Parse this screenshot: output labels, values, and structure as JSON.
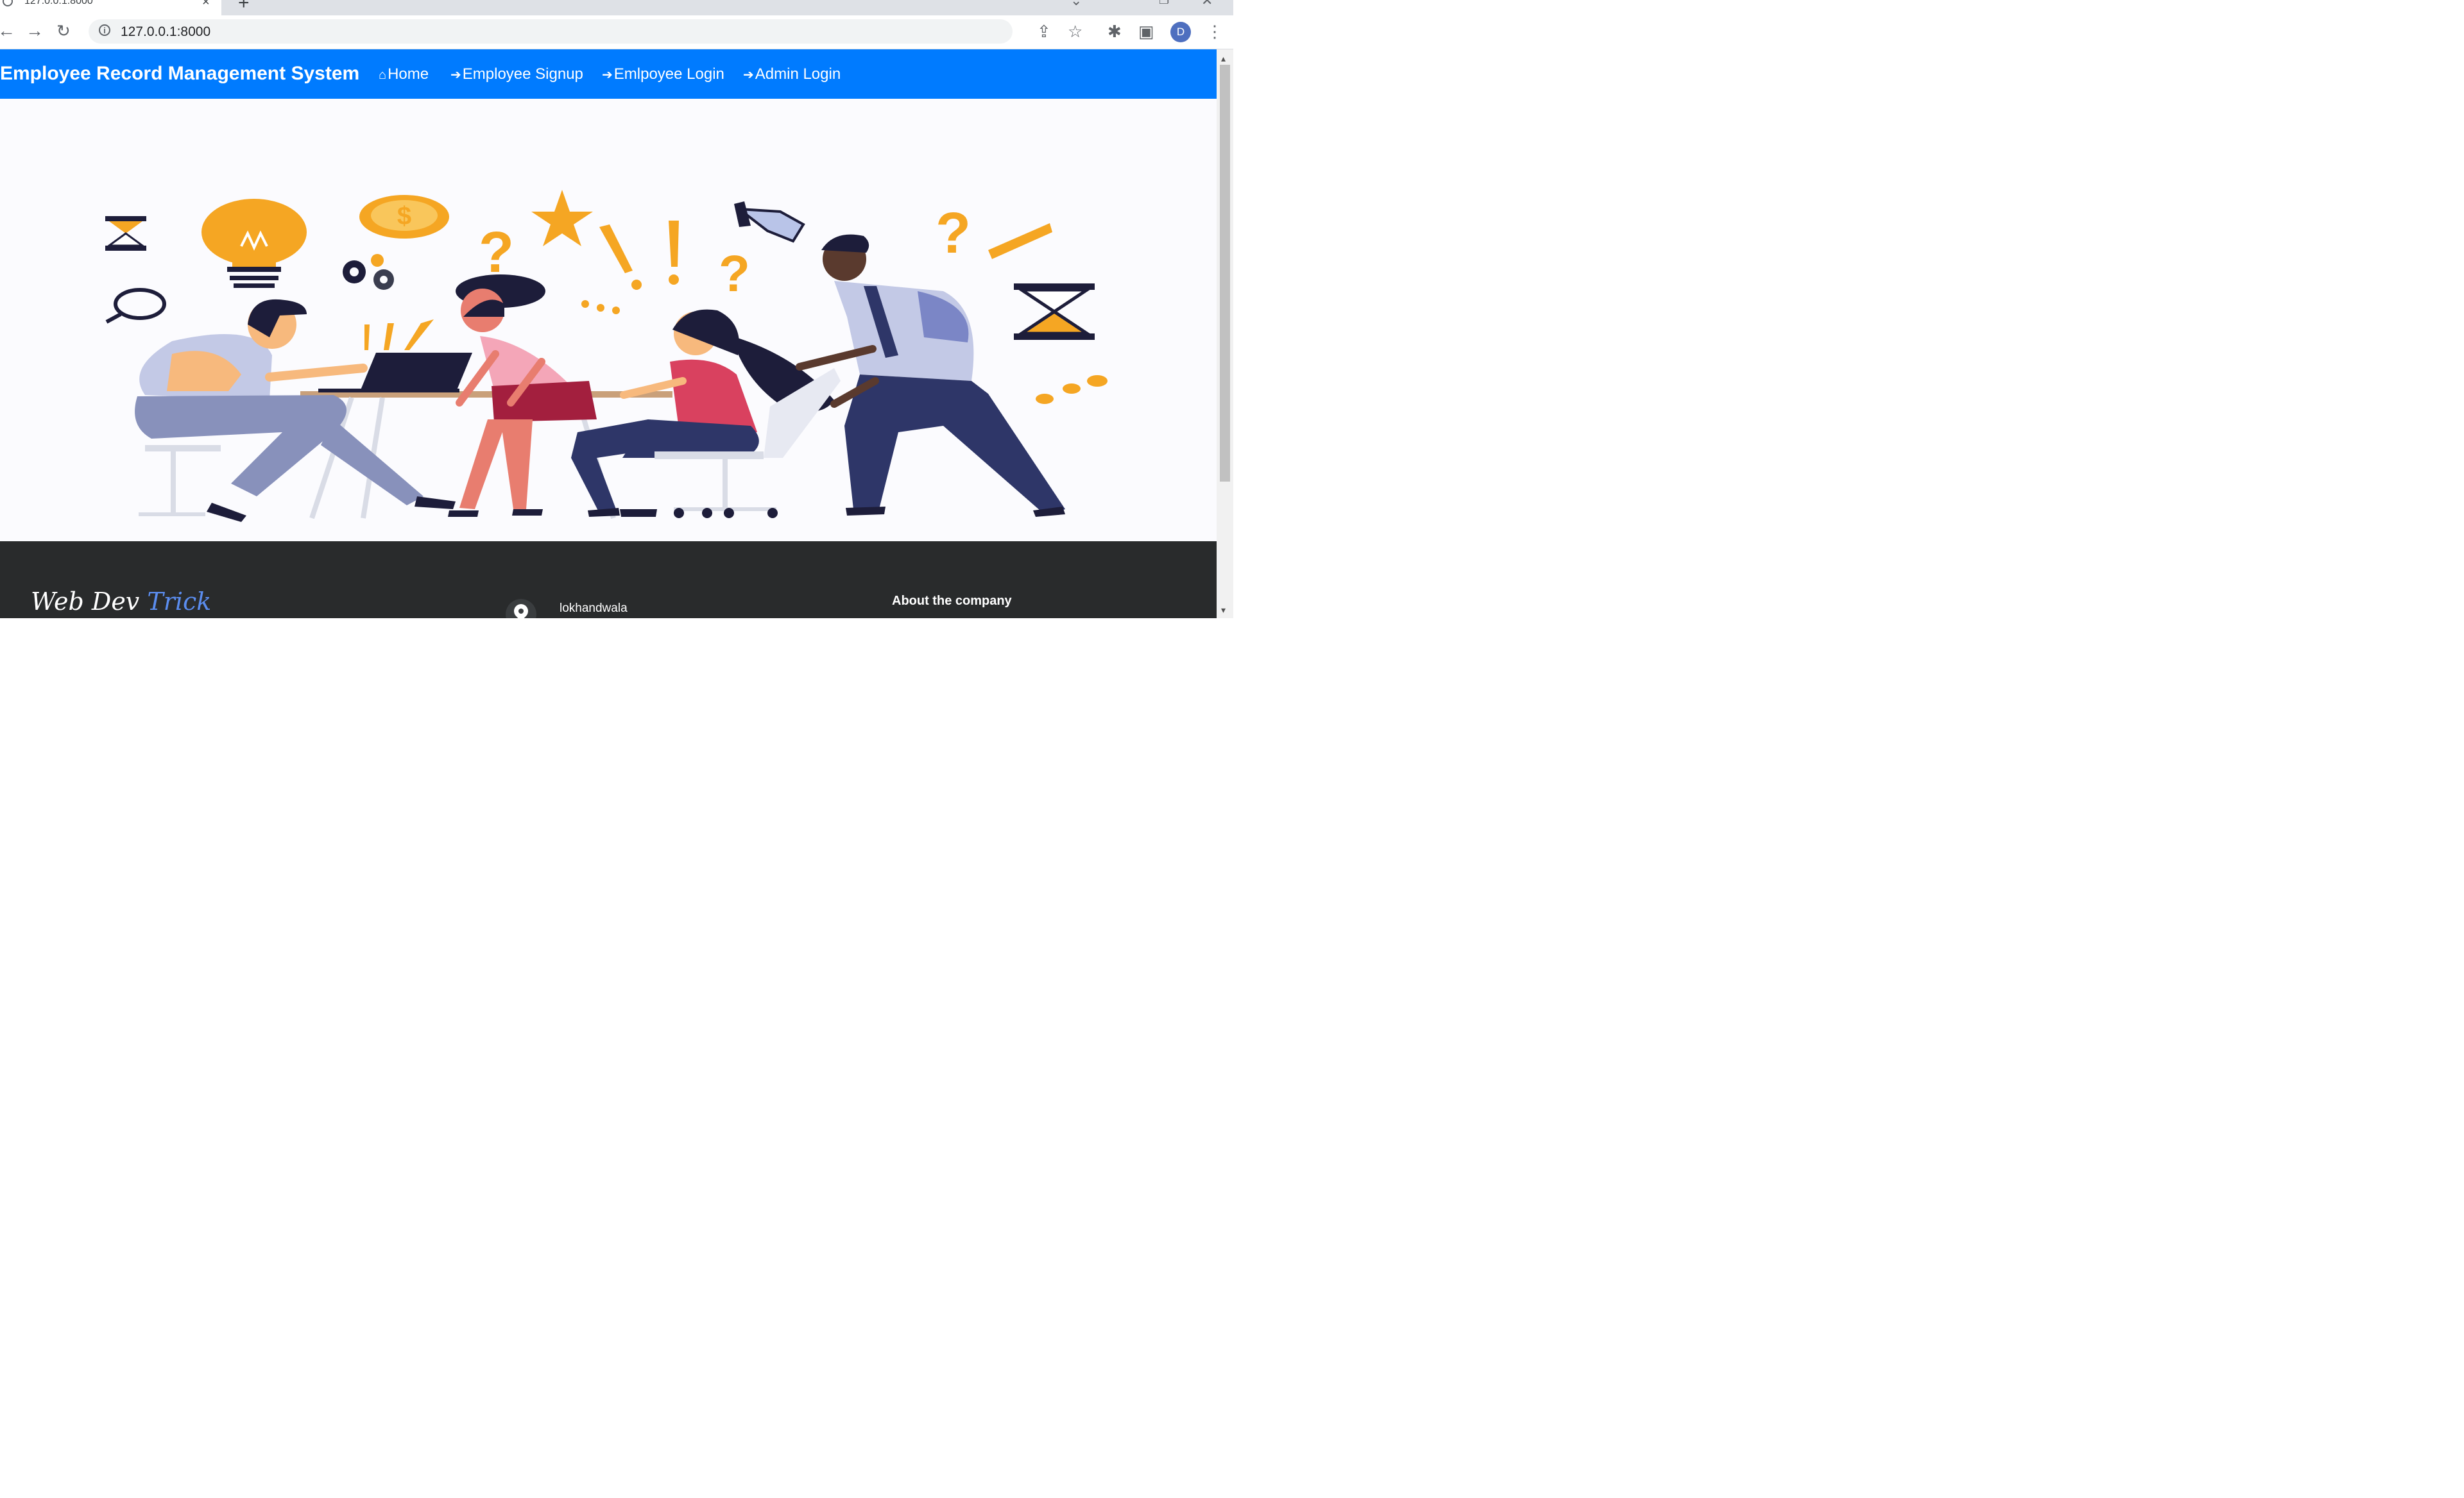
{
  "browser": {
    "tab_title": "127.0.0.1:8000",
    "tab_close": "×",
    "new_tab": "+",
    "url": "127.0.0.1:8000",
    "profile_initial": "D",
    "icons": [
      "back-icon",
      "forward-icon",
      "reload-icon",
      "info-icon",
      "share-icon",
      "star-icon",
      "extensions-icon",
      "side-panel-icon",
      "profile-avatar",
      "menu-icon",
      "minimize-icon",
      "restore-icon",
      "close-icon"
    ]
  },
  "navbar": {
    "brand": "Employee Record Management System",
    "links": [
      {
        "label": "Home",
        "icon": "home-icon"
      },
      {
        "label": "Employee Signup",
        "icon": "sign-in-icon"
      },
      {
        "label": "Emlpoyee Login",
        "icon": "sign-in-icon"
      },
      {
        "label": "Admin Login",
        "icon": "sign-in-icon"
      }
    ],
    "color": "#007bff"
  },
  "hero": {
    "illustration": "team-brainstorm-illustration",
    "accent_color": "#f5a623"
  },
  "footer": {
    "logo_main": "Web Dev ",
    "logo_accent": "Trick",
    "address": "lokhandwala",
    "about_heading": "About the company",
    "background": "#292b2c"
  }
}
